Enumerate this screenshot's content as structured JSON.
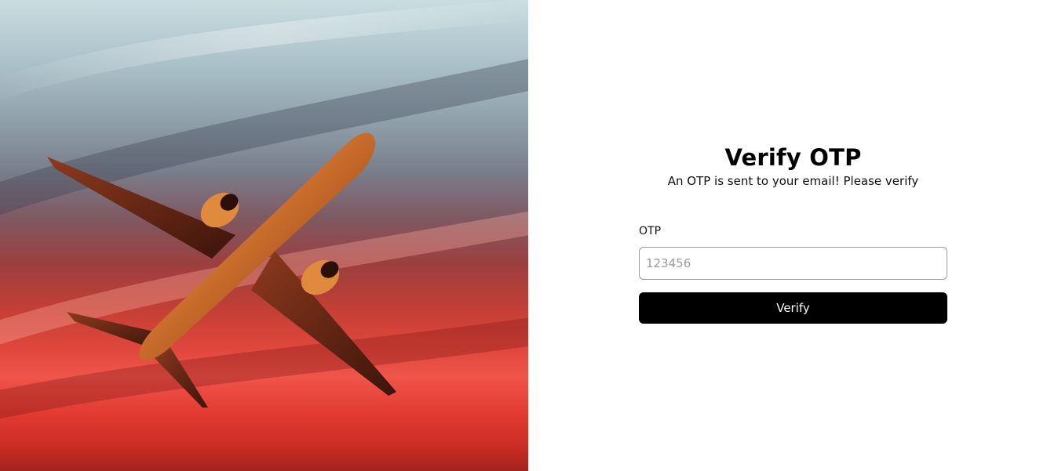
{
  "hero": {
    "image": "airplane-sunset-photo"
  },
  "form": {
    "title": "Verify OTP",
    "subtitle": "An OTP is sent to your email! Please verify",
    "otp_label": "OTP",
    "otp_placeholder": "123456",
    "otp_value": "",
    "verify_label": "Verify"
  },
  "colors": {
    "button_bg": "#000000",
    "button_text": "#ffffff",
    "input_border": "#9a9a9a",
    "placeholder": "#9a9a9a"
  }
}
